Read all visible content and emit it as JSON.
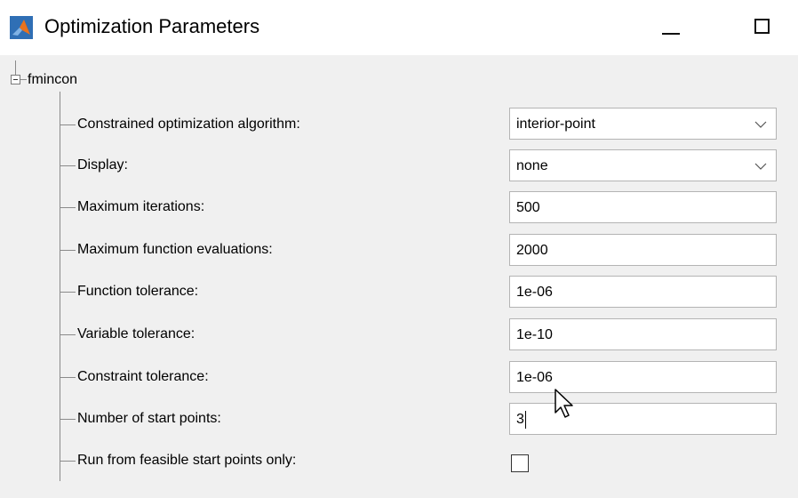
{
  "window": {
    "title": "Optimization Parameters"
  },
  "tree": {
    "root_label": "fmincon",
    "rows": [
      {
        "label": "Constrained optimization algorithm:",
        "type": "select",
        "value": "interior-point"
      },
      {
        "label": "Display:",
        "type": "select",
        "value": "none"
      },
      {
        "label": "Maximum iterations:",
        "type": "text",
        "value": "500"
      },
      {
        "label": "Maximum function evaluations:",
        "type": "text",
        "value": "2000"
      },
      {
        "label": "Function tolerance:",
        "type": "text",
        "value": "1e-06"
      },
      {
        "label": "Variable tolerance:",
        "type": "text",
        "value": "1e-10"
      },
      {
        "label": "Constraint tolerance:",
        "type": "text",
        "value": "1e-06"
      },
      {
        "label": "Number of start points:",
        "type": "text",
        "value": "3"
      },
      {
        "label": "Run from feasible start points only:",
        "type": "checkbox",
        "checked": false
      }
    ]
  },
  "icons": {
    "app": "matlab-icon",
    "dropdown": "chevron-down-icon",
    "pointer": "mouse-pointer-icon"
  },
  "colors": {
    "content_background": "#f0f0f0",
    "field_border": "#b4b4b4",
    "matlab_orange": "#e8731f",
    "matlab_blue": "#2f6fb5"
  }
}
